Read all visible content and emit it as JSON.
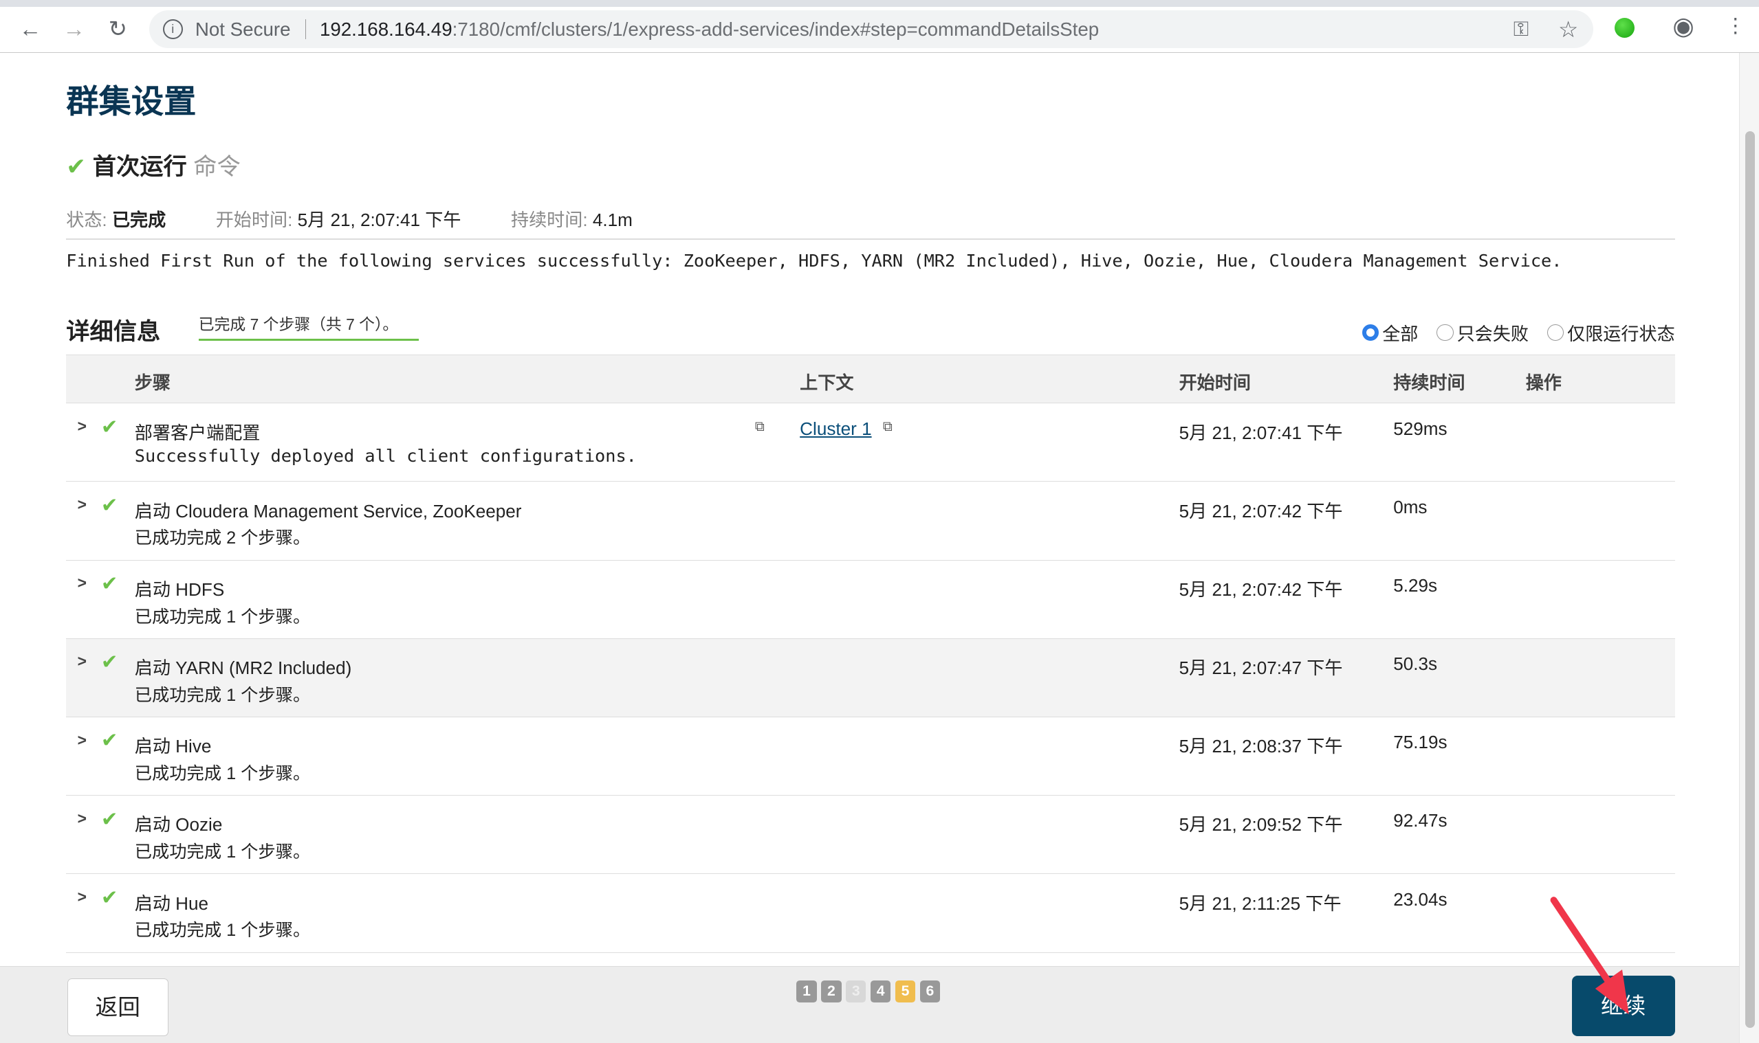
{
  "browser": {
    "security": "Not Secure",
    "url_host": "192.168.164.49",
    "url_rest": ":7180/cmf/clusters/1/express-add-services/index#step=commandDetailsStep"
  },
  "page": {
    "title": "群集设置",
    "command_name": "首次运行",
    "command_suffix": "命令",
    "status_label": "状态:",
    "status_value": "已完成",
    "start_label": "开始时间:",
    "start_value": "5月 21, 2:07:41 下午",
    "duration_label": "持续时间:",
    "duration_value": "4.1m",
    "message": "Finished First Run of the following services successfully: ZooKeeper, HDFS, YARN (MR2 Included), Hive, Oozie, Hue, Cloudera Management Service."
  },
  "details": {
    "heading": "详细信息",
    "progress": "已完成 7 个步骤（共 7 个）。",
    "filters": [
      {
        "label": "全部",
        "selected": true
      },
      {
        "label": "只会失败",
        "selected": false
      },
      {
        "label": "仅限运行状态",
        "selected": false
      }
    ],
    "columns": [
      "步骤",
      "上下文",
      "开始时间",
      "持续时间",
      "操作"
    ],
    "rows": [
      {
        "name": "部署客户端配置",
        "desc": "Successfully deployed all client configurations.",
        "context": "Cluster 1",
        "time": "5月 21, 2:07:41 下午",
        "duration": "529ms"
      },
      {
        "name": "启动 Cloudera Management Service, ZooKeeper",
        "desc": "已成功完成 2 个步骤。",
        "time": "5月 21, 2:07:42 下午",
        "duration": "0ms"
      },
      {
        "name": "启动 HDFS",
        "desc": "已成功完成 1 个步骤。",
        "time": "5月 21, 2:07:42 下午",
        "duration": "5.29s"
      },
      {
        "name": "启动 YARN (MR2 Included)",
        "desc": "已成功完成 1 个步骤。",
        "time": "5月 21, 2:07:47 下午",
        "duration": "50.3s"
      },
      {
        "name": "启动 Hive",
        "desc": "已成功完成 1 个步骤。",
        "time": "5月 21, 2:08:37 下午",
        "duration": "75.19s"
      },
      {
        "name": "启动 Oozie",
        "desc": "已成功完成 1 个步骤。",
        "time": "5月 21, 2:09:52 下午",
        "duration": "92.47s"
      },
      {
        "name": "启动 Hue",
        "desc": "已成功完成 1 个步骤。",
        "time": "5月 21, 2:11:25 下午",
        "duration": "23.04s"
      }
    ]
  },
  "footer": {
    "back": "返回",
    "continue": "继续",
    "pages": [
      "1",
      "2",
      "3",
      "4",
      "5",
      "6"
    ],
    "current_page": "5"
  },
  "colors": {
    "accent": "#074a6b",
    "success": "#6cc04a",
    "current_step": "#f0bd4e",
    "annotation_arrow": "#f0364a"
  }
}
